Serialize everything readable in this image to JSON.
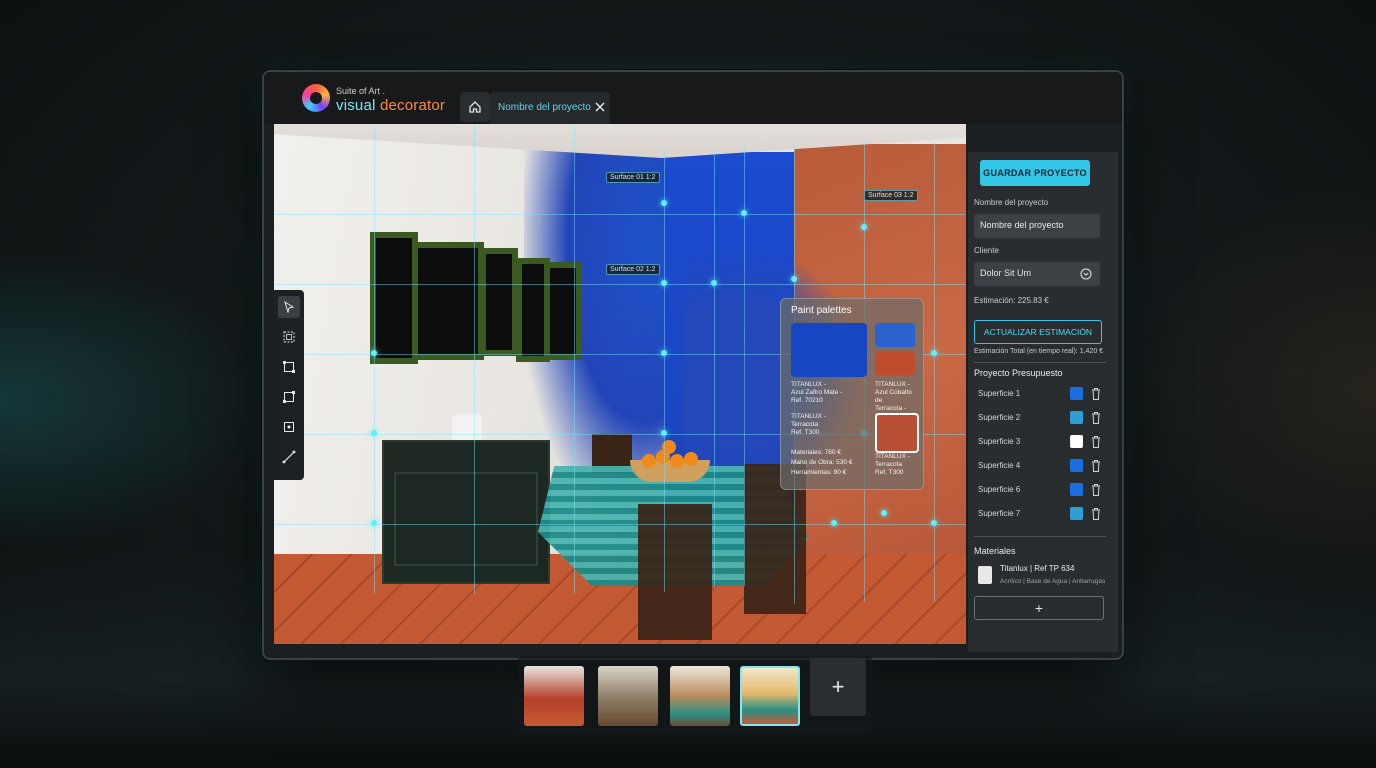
{
  "app": {
    "brand_small": "Suite of Art .",
    "brand_name_part1": "visual",
    "brand_name_part2": "decorator",
    "tab_label": "Nombre del proyecto"
  },
  "canvas": {
    "dimension_labels": [
      "Surface 01 1:2",
      "Surface 02 1:2",
      "Surface 03 1:2"
    ]
  },
  "palette": {
    "title": "Paint palettes",
    "item1": "TITANLUX -\nAzul Zafiro Mate -\nRef. 70210",
    "item2": "TITANLUX -\nAzul Cobalto de\nTerracota - Ref. T300",
    "item3": "TITANLUX -\nTerracota\nRef. T300",
    "item4": "TITANLUX -\nTerracota\nRef. T300",
    "materials": "Materiales: 780 €",
    "labor": "Mano de Obra: 530 €",
    "tools": "Herramientas: 90 €"
  },
  "panel": {
    "save_label": "GUARDAR PROYECTO",
    "project_name_label": "Nombre del proyecto",
    "project_name_value": "Nombre del proyecto",
    "client_label": "Cliente",
    "client_value": "Dolor Sit Um",
    "estimate_text": "Estimación: 225.83 €",
    "update_label": "ACTUALIZAR ESTIMACIÓN",
    "realtime_text": "Estimación Total (en tiempo real): 1,420 €",
    "budget_title": "Proyecto Presupuesto",
    "surfaces": [
      {
        "label": "Superficie 1",
        "color": "#1a6fe0"
      },
      {
        "label": "Superficie 2",
        "color": "#2f9ed8"
      },
      {
        "label": "Superficie 3",
        "color": "#ffffff"
      },
      {
        "label": "Superficie 4",
        "color": "#1a6fe0"
      },
      {
        "label": "Superficie 6",
        "color": "#1a6fe0"
      },
      {
        "label": "Superficie 7",
        "color": "#2f9ed8"
      }
    ],
    "materials_title": "Materiales",
    "material_name": "Titanlux   |   Ref TP 634",
    "material_sub": "Acrílico  |  Base de Agua  |  Antiarrugas",
    "add_symbol": "+"
  },
  "thumbnails": {
    "add_symbol": "+",
    "selected_index": 3
  },
  "colors": {
    "accent": "#34c6e6",
    "brand_orange": "#ff8a3c"
  }
}
